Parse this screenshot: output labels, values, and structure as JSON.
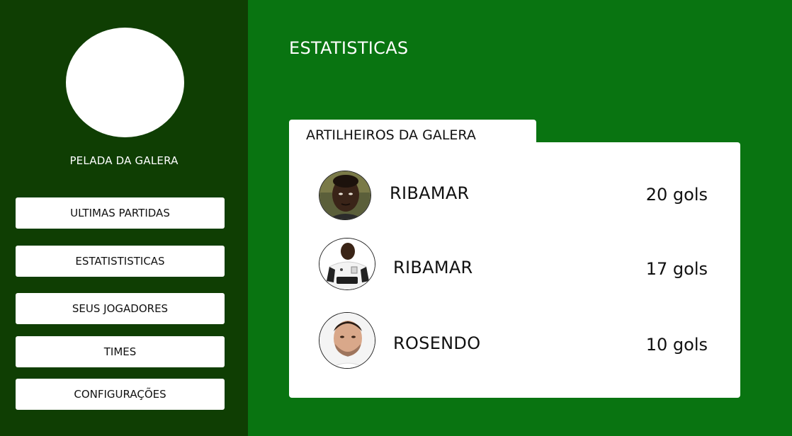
{
  "sidebar": {
    "group_name": "PELADA DA GALERA",
    "nav": [
      {
        "label": "ULTIMAS PARTIDAS"
      },
      {
        "label": "ESTATISTISTICAS"
      },
      {
        "label": "SEUS JOGADORES"
      },
      {
        "label": "TIMES"
      },
      {
        "label": "CONFIGURAÇÕES"
      }
    ]
  },
  "main": {
    "title": "ESTATISTICAS",
    "card": {
      "tab_label": "ARTILHEIROS DA GALERA",
      "players": [
        {
          "name": "RIBAMAR",
          "goals": "20 gols"
        },
        {
          "name": "RIBAMAR",
          "goals": "17 gols"
        },
        {
          "name": "ROSENDO",
          "goals": "10 gols"
        }
      ]
    }
  },
  "colors": {
    "sidebar_bg": "#0f3e03",
    "main_bg": "#097411",
    "card_bg": "#ffffff"
  }
}
